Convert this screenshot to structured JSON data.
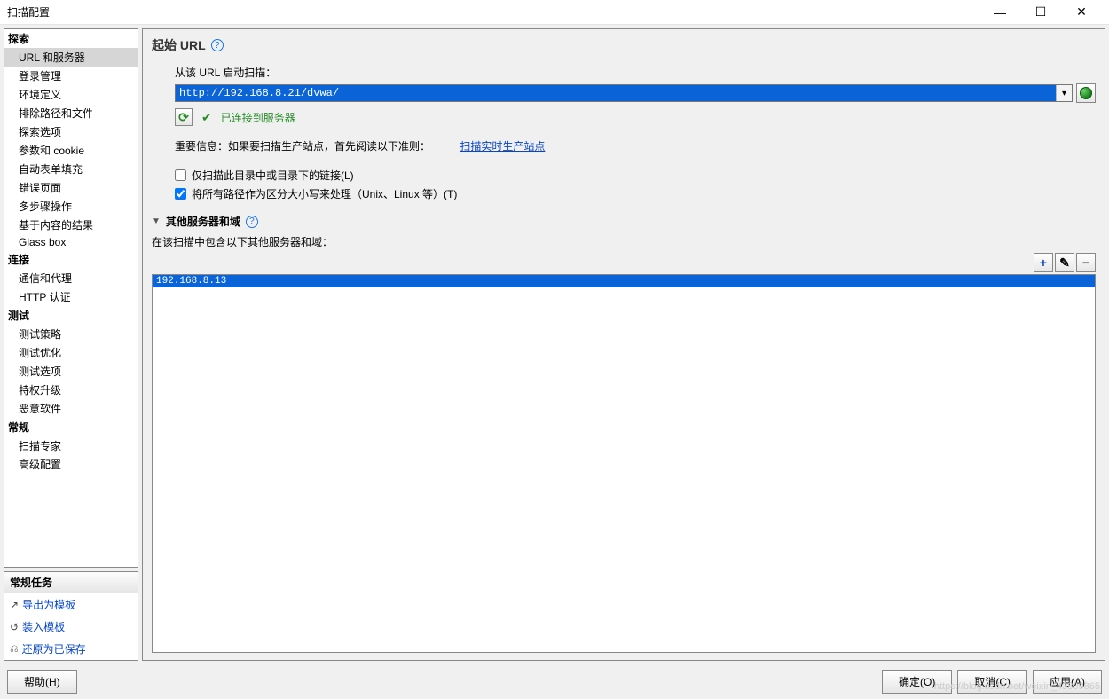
{
  "window": {
    "title": "扫描配置"
  },
  "win_controls": {
    "min": "—",
    "max": "☐",
    "close": "✕"
  },
  "nav": {
    "groups": [
      {
        "label": "探索",
        "items": [
          {
            "label": "URL 和服务器",
            "selected": true
          },
          {
            "label": "登录管理"
          },
          {
            "label": "环境定义"
          },
          {
            "label": "排除路径和文件"
          },
          {
            "label": "探索选项"
          },
          {
            "label": "参数和 cookie"
          },
          {
            "label": "自动表单填充"
          },
          {
            "label": "错误页面"
          },
          {
            "label": "多步骤操作"
          },
          {
            "label": "基于内容的结果"
          },
          {
            "label": "Glass box"
          }
        ]
      },
      {
        "label": "连接",
        "items": [
          {
            "label": "通信和代理"
          },
          {
            "label": "HTTP 认证"
          }
        ]
      },
      {
        "label": "测试",
        "items": [
          {
            "label": "测试策略"
          },
          {
            "label": "测试优化"
          },
          {
            "label": "测试选项"
          },
          {
            "label": "特权升级"
          },
          {
            "label": "恶意软件"
          }
        ]
      },
      {
        "label": "常规",
        "items": [
          {
            "label": "扫描专家"
          },
          {
            "label": "高级配置"
          }
        ]
      }
    ]
  },
  "tasks": {
    "header": "常规任务",
    "items": [
      {
        "icon": "↗",
        "label": "导出为模板"
      },
      {
        "icon": "↺",
        "label": "装入模板"
      },
      {
        "icon": "⎌",
        "label": "还原为已保存"
      }
    ]
  },
  "main": {
    "title": "起始 URL",
    "url_label": "从该 URL 启动扫描：",
    "url_value": "http://192.168.8.21/dvwa/",
    "status_text": "已连接到服务器",
    "info_prefix": "重要信息：如果要扫描生产站点，首先阅读以下准则：",
    "info_link": "扫描实时生产站点",
    "check1": {
      "checked": false,
      "label": "仅扫描此目录中或目录下的链接(L)"
    },
    "check2": {
      "checked": true,
      "label": "将所有路径作为区分大小写来处理（Unix、Linux 等）(T)"
    },
    "sub_title": "其他服务器和域",
    "sub_label": "在该扫描中包含以下其他服务器和域：",
    "toolbar": {
      "add": "+",
      "edit": "✎",
      "remove": "−"
    },
    "domains": [
      "192.168.8.13"
    ]
  },
  "footer": {
    "help": "帮助(H)",
    "ok": "确定(O)",
    "cancel": "取消(C)",
    "apply": "应用(A)"
  },
  "watermark": "https://blog.csdn.net/weixin_43809865"
}
